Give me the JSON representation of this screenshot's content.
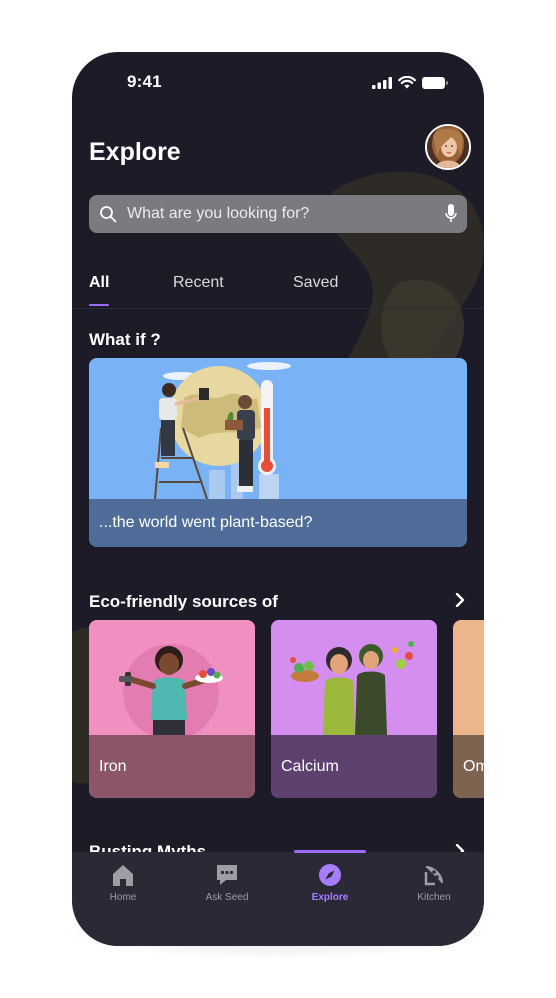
{
  "status_bar": {
    "time": "9:41"
  },
  "header": {
    "title": "Explore"
  },
  "search": {
    "placeholder": "What are you looking for?"
  },
  "tabs": [
    {
      "label": "All",
      "active": true
    },
    {
      "label": "Recent",
      "active": false
    },
    {
      "label": "Saved",
      "active": false
    }
  ],
  "what_if": {
    "title": "What if ?",
    "card_caption": "...the world went plant-based?"
  },
  "eco": {
    "title": "Eco-friendly sources of",
    "cards": [
      {
        "label": "Iron",
        "color": "#ef90c0",
        "caption_color": "#8b5668"
      },
      {
        "label": "Calcium",
        "color": "#d48ef0",
        "caption_color": "#5d4270"
      },
      {
        "label": "Om",
        "color": "#ecb68c",
        "caption_color": "#7e6351"
      }
    ]
  },
  "busting": {
    "title": "Busting Myths"
  },
  "bottom_nav": [
    {
      "label": "Home",
      "icon": "home-icon",
      "active": false
    },
    {
      "label": "Ask Seed",
      "icon": "chat-icon",
      "active": false
    },
    {
      "label": "Explore",
      "icon": "compass-icon",
      "active": true
    },
    {
      "label": "Kitchen",
      "icon": "pizza-icon",
      "active": false
    }
  ],
  "colors": {
    "background": "#1c1b27",
    "accent": "#9b6bff",
    "nav_bg": "#2a2a37"
  }
}
